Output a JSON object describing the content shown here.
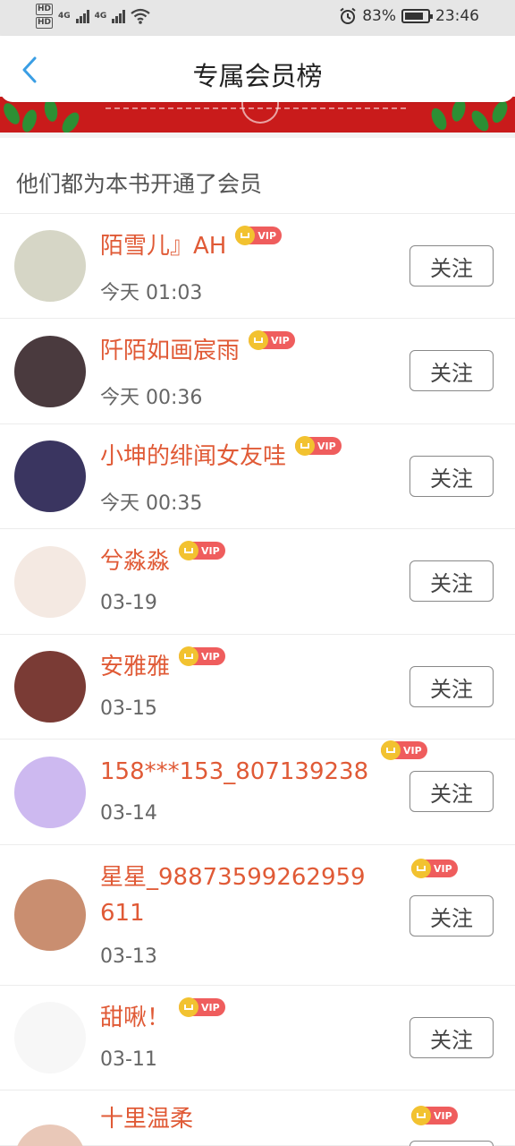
{
  "status_bar": {
    "left_label_1": "HD",
    "left_label_2": "HD",
    "network_1": "4G",
    "network_2": "4G",
    "battery_percent": "83%",
    "battery_level": 0.83,
    "time": "23:46"
  },
  "header": {
    "title": "专属会员榜"
  },
  "section": {
    "title": "他们都为本书开通了会员"
  },
  "vip_label": "VIP",
  "follow_label": "关注",
  "members": [
    {
      "name": "陌雪儿』AH",
      "time": "今天 01:03",
      "avatar_color": "#d6d6c6"
    },
    {
      "name": "阡陌如画宸雨",
      "time": "今天 00:36",
      "avatar_color": "#4a3a3e"
    },
    {
      "name": "小坤的绯闻女友哇",
      "time": "今天 00:35",
      "avatar_color": "#3a3560"
    },
    {
      "name": "兮淼淼",
      "time": "03-19",
      "avatar_color": "#f4e9e2"
    },
    {
      "name": "安雅雅",
      "time": "03-15",
      "avatar_color": "#7a3b35"
    },
    {
      "name": "158***153_807139238",
      "time": "03-14",
      "avatar_color": "#cdb9f0"
    },
    {
      "name": "星星_98873599262959611",
      "time": "03-13",
      "avatar_color": "#c98e70"
    },
    {
      "name": "甜啾！",
      "time": "03-11",
      "avatar_color": "#f7f7f7"
    },
    {
      "name": "十里温柔",
      "time": "",
      "avatar_color": "#e9c8b8"
    }
  ]
}
